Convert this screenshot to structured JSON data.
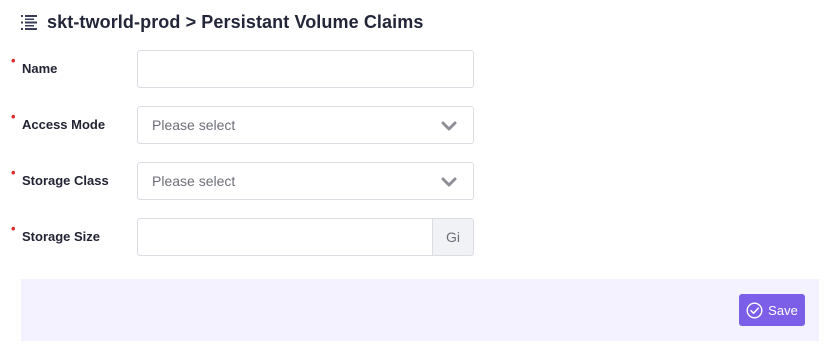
{
  "header": {
    "title": "skt-tworld-prod > Persistant Volume Claims",
    "icon": "list-icon"
  },
  "form": {
    "required_marker": "•",
    "name": {
      "label": "Name",
      "value": ""
    },
    "access_mode": {
      "label": "Access Mode",
      "placeholder": "Please select"
    },
    "storage_class": {
      "label": "Storage Class",
      "placeholder": "Please select"
    },
    "storage_size": {
      "label": "Storage Size",
      "value": "",
      "unit": "Gi"
    }
  },
  "footer": {
    "save_label": "Save",
    "save_icon": "check-circle-icon"
  },
  "colors": {
    "accent": "#7b5fe8",
    "footer_bg": "#f4f2ff",
    "required": "#e02b2b"
  }
}
